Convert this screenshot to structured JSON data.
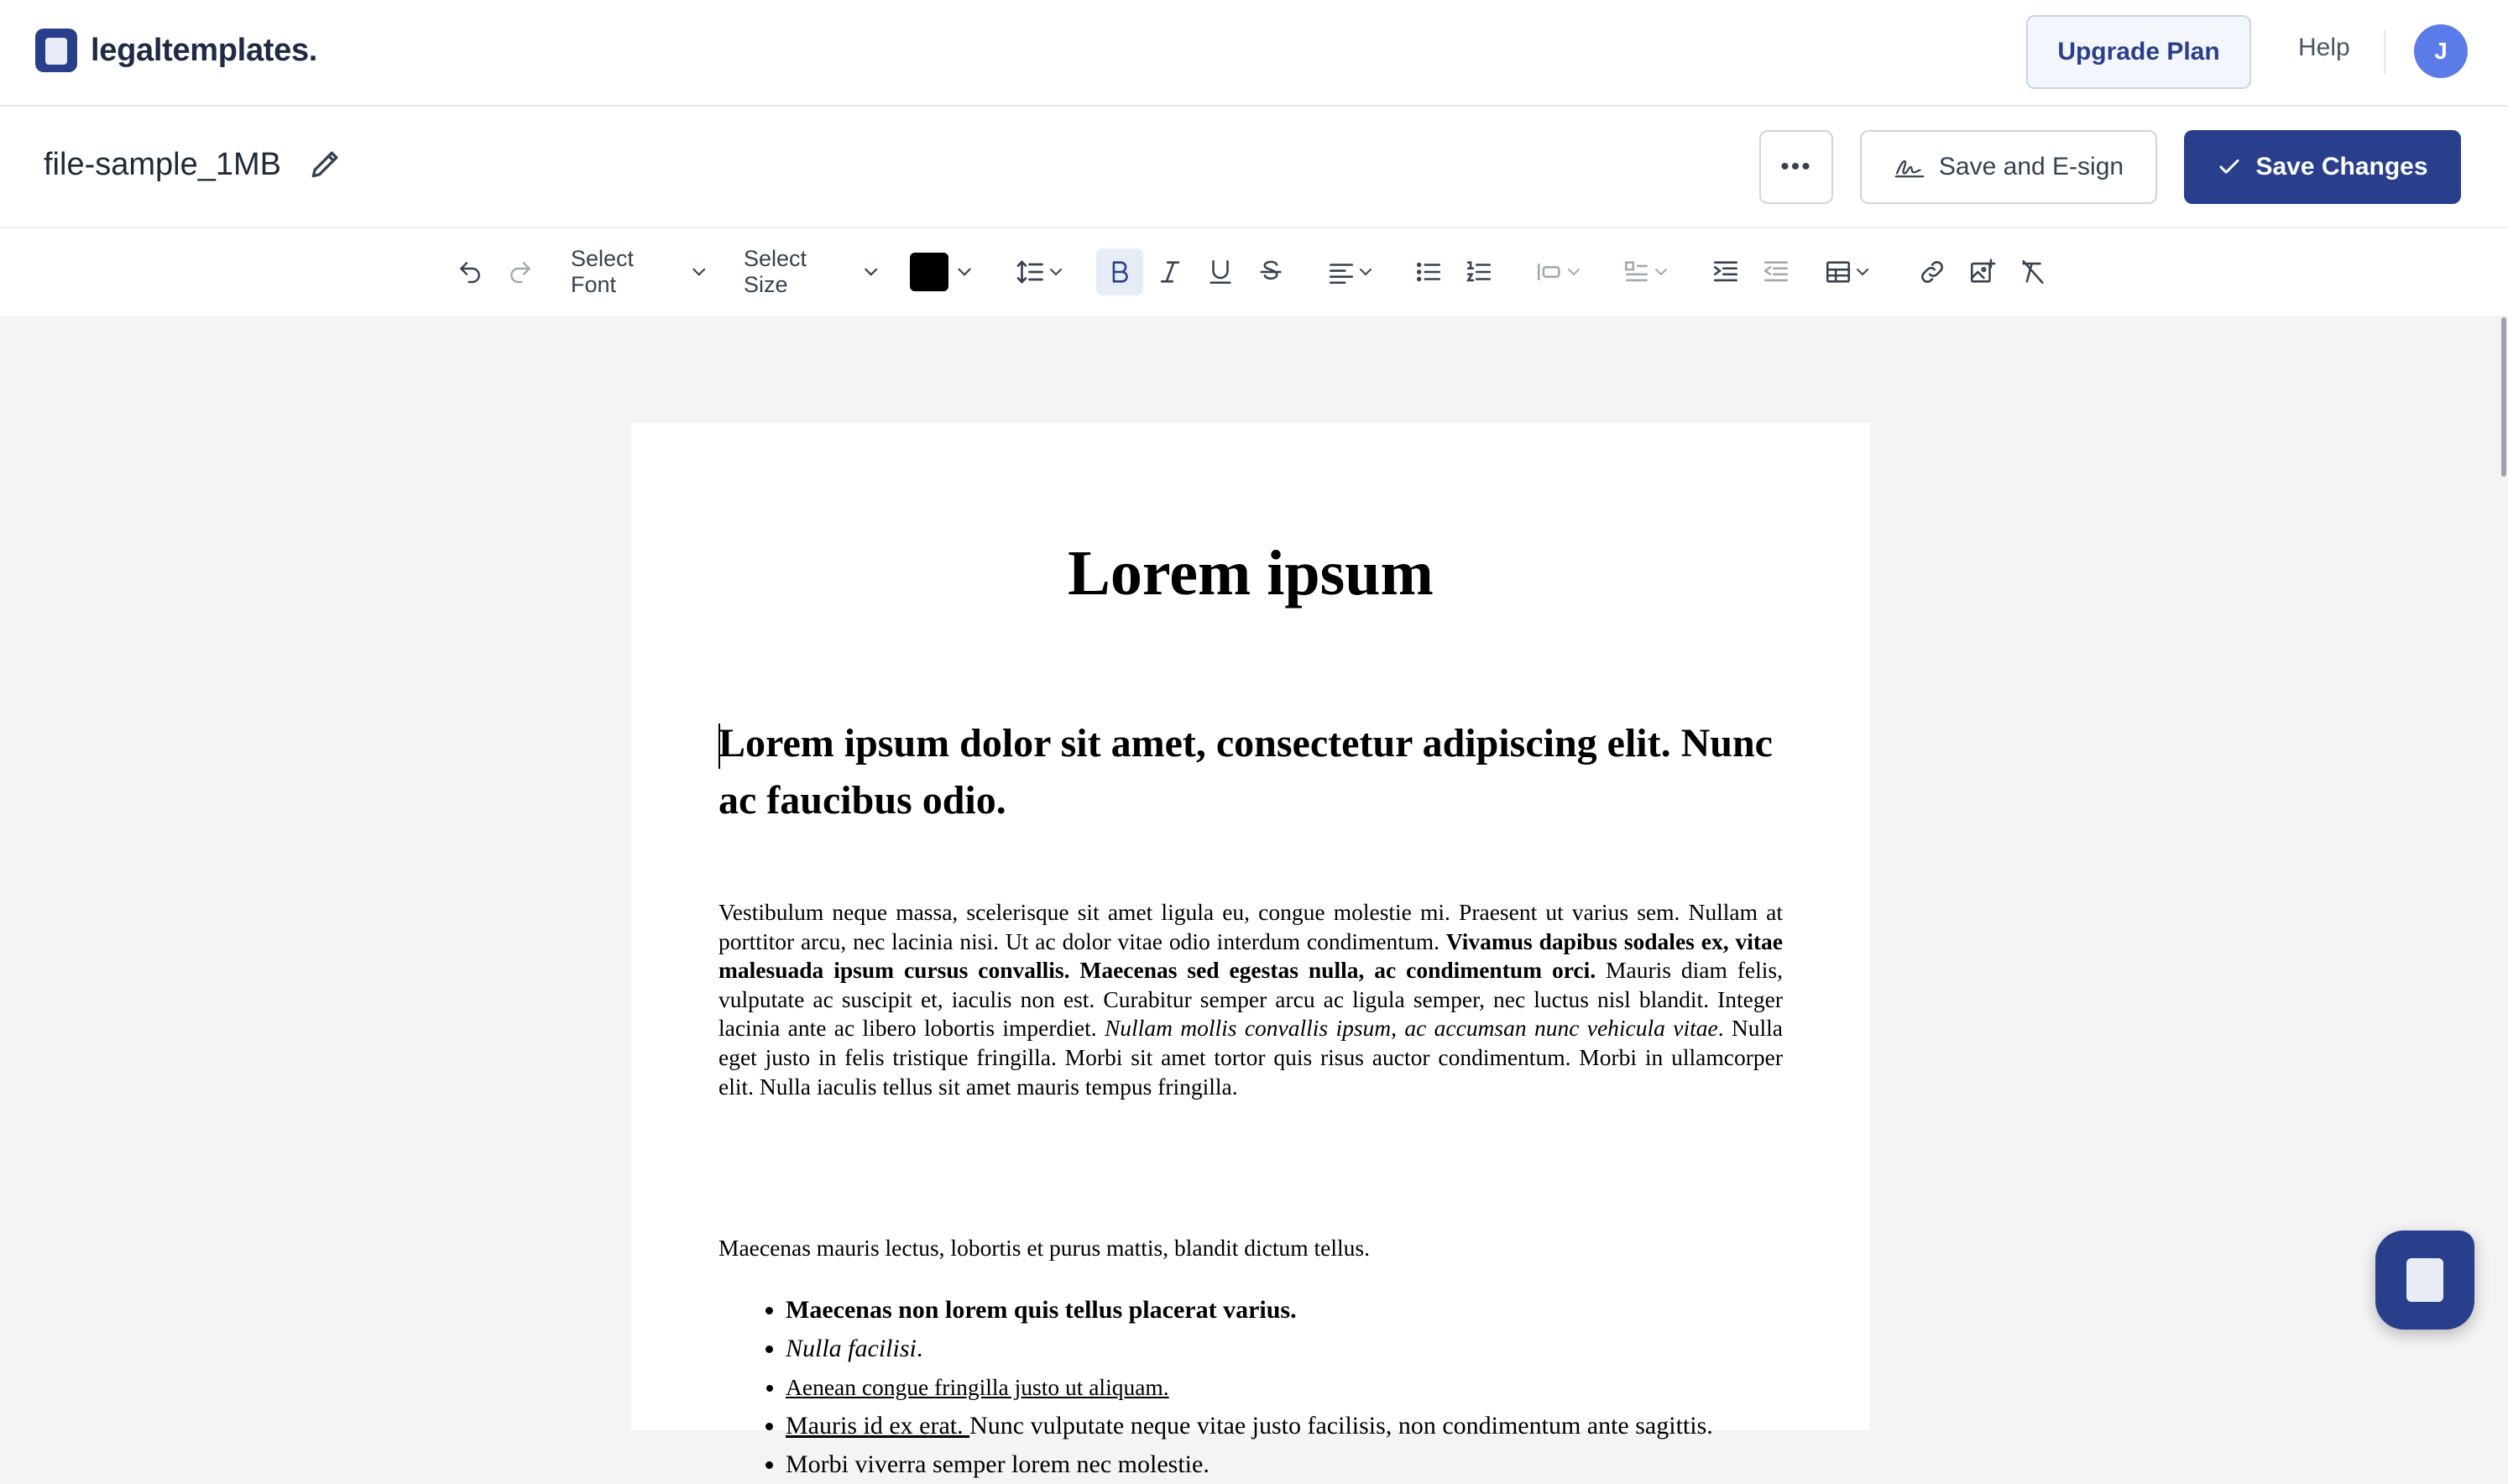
{
  "brand": {
    "name": "legaltemplates."
  },
  "topbar": {
    "upgrade_label": "Upgrade Plan",
    "help_label": "Help",
    "avatar_initial": "J"
  },
  "document": {
    "filename": "file-sample_1MB",
    "more_label": "•••",
    "esign_label": "Save and E-sign",
    "save_label": "Save Changes"
  },
  "toolbar": {
    "font_select": "Select Font",
    "size_select": "Select Size",
    "text_color": "#000000"
  },
  "content": {
    "title": "Lorem ipsum",
    "heading": "Lorem ipsum dolor sit amet, consectetur adipiscing elit. Nunc ac faucibus odio.",
    "p1": {
      "s1": "Vestibulum neque massa, scelerisque sit amet ligula eu, congue molestie mi. Praesent ut varius sem. Nullam at porttitor arcu, nec lacinia nisi. Ut ac dolor vitae odio interdum condimentum. ",
      "s2": "Vivamus dapibus sodales ex, vitae malesuada ipsum cursus convallis. Maecenas sed egestas nulla, ac condimentum orci.",
      "s3": " Mauris diam felis, vulputate ac suscipit et, iaculis non est. Curabitur semper arcu ac ligula semper, nec luctus nisl blandit. Integer lacinia ante ac libero lobortis imperdiet. ",
      "s4": "Nullam mollis convallis ipsum, ac accumsan nunc vehicula vitae",
      "s5": ". Nulla eget justo in felis tristique fringilla. Morbi sit amet tortor quis risus auctor condimentum. Morbi in ullamcorper elit. Nulla iaculis tellus sit amet mauris tempus fringilla."
    },
    "p2": "Maecenas mauris lectus, lobortis et purus mattis, blandit dictum tellus.",
    "list": {
      "item1": "Maecenas non lorem quis tellus placerat varius.",
      "item2": "Nulla facilisi",
      "item2_tail": ".",
      "item3": "Aenean congue fringilla justo ut aliquam.",
      "item4_u": "Mauris id ex erat. ",
      "item4_rest": "Nunc vulputate neque vitae justo facilisis, non condimentum ante sagittis.",
      "item5": "Morbi viverra semper lorem nec molestie."
    }
  },
  "colors": {
    "primary": "#2a3f8c",
    "avatar": "#5b7be8",
    "canvas": "#f4f4f5"
  }
}
